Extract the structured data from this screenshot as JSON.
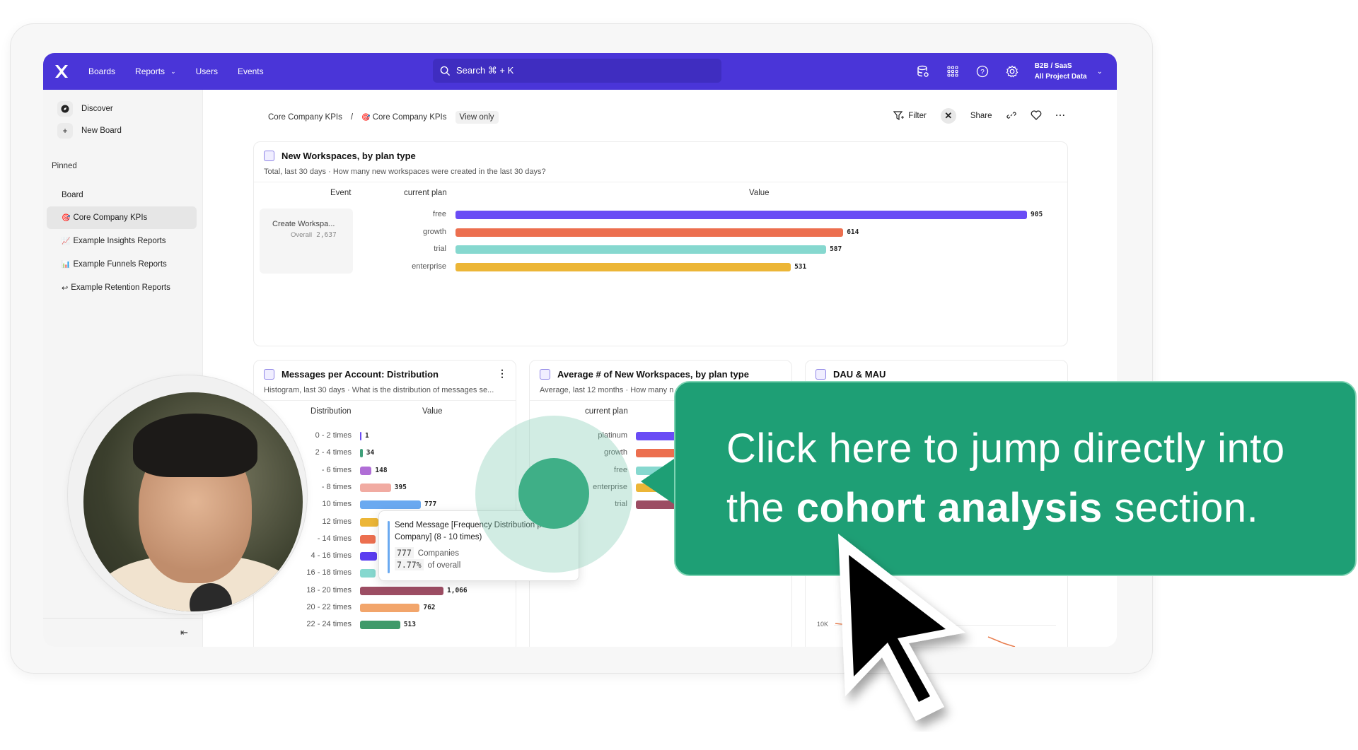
{
  "topnav": {
    "links": [
      {
        "label": "Boards"
      },
      {
        "label": "Reports",
        "has_dropdown": true
      },
      {
        "label": "Users"
      },
      {
        "label": "Events"
      }
    ],
    "search_placeholder": "Search  ⌘ + K",
    "icons": [
      "database-settings-icon",
      "apps-grid-icon",
      "help-icon",
      "settings-gear-icon"
    ],
    "project": {
      "name": "B2B / SaaS",
      "scope": "All Project Data"
    },
    "brand_color": "#4a35d8"
  },
  "sidebar": {
    "top_items": [
      {
        "label": "Discover",
        "icon": "compass-icon"
      },
      {
        "label": "New Board",
        "icon": "plus-icon"
      }
    ],
    "pinned_label": "Pinned",
    "pinned": [
      {
        "label": "Board",
        "emoji": ""
      },
      {
        "label": "Core Company KPIs",
        "emoji": "🎯",
        "active": true
      },
      {
        "label": "Example Insights Reports",
        "emoji": "📈"
      },
      {
        "label": "Example Funnels Reports",
        "emoji": "📊"
      },
      {
        "label": "Example Retention Reports",
        "emoji": "↩"
      }
    ],
    "collapse_icon": "⇤"
  },
  "breadcrumb": {
    "parent": "Core Company KPIs",
    "separator": "/",
    "current_emoji": "🎯",
    "current": "Core Company KPIs",
    "badge": "View only"
  },
  "actions": {
    "filter": "Filter",
    "share": "Share"
  },
  "cards": {
    "new_workspaces": {
      "title": "New Workspaces, by plan type",
      "subtitle": "Total, last 30 days · How many new workspaces were created in the last 30 days?",
      "col_event": "Event",
      "col_plan": "current plan",
      "col_value": "Value",
      "event_name": "Create Workspa...",
      "event_overall_label": "Overall",
      "event_overall_value": "2,637"
    },
    "messages": {
      "title": "Messages per Account: Distribution",
      "subtitle": "Histogram, last 30 days · What is the distribution of messages se...",
      "col_dist": "Distribution",
      "col_value": "Value"
    },
    "avg_workspaces": {
      "title": "Average # of New Workspaces, by plan type",
      "subtitle": "Average, last 12 months · How many n",
      "col_plan": "current plan"
    },
    "dau_mau": {
      "title": "DAU & MAU",
      "axis_tick": "10K"
    }
  },
  "tooltip": {
    "line1": "Send Message [Frequency Distribution per",
    "line2": "Company] (8 - 10 times)",
    "count": "777",
    "count_label": "Companies",
    "pct": "7.77%",
    "pct_label": "of overall"
  },
  "callout": {
    "line1": "Click here to jump directly into",
    "line2_pre": "the ",
    "line2_bold": "cohort analysis",
    "line2_post": " section.",
    "color": "#1e9f75"
  },
  "chart_data": [
    {
      "type": "bar",
      "title": "New Workspaces, by plan type",
      "orientation": "horizontal",
      "categories": [
        "free",
        "growth",
        "trial",
        "enterprise"
      ],
      "values": [
        905,
        614,
        587,
        531
      ],
      "labels": [
        "905",
        "614",
        "587",
        "531"
      ],
      "colors": [
        "#6a4cf5",
        "#ec6f4f",
        "#86d8cf",
        "#ecb637"
      ],
      "xlim": [
        0,
        905
      ]
    },
    {
      "type": "bar",
      "title": "Messages per Account: Distribution",
      "orientation": "horizontal",
      "categories": [
        "0 - 2 times",
        "2 - 4 times",
        "4 - 6 times",
        "6 - 8 times",
        "8 - 10 times",
        "10 - 12 times",
        "12 - 14 times",
        "14 - 16 times",
        "16 - 18 times",
        "18 - 20 times",
        "20 - 22 times",
        "22 - 24 times"
      ],
      "visible_labels": [
        "0 - 2 times",
        "2 - 4 times",
        "- 6 times",
        "- 8 times",
        "10 times",
        "12 times",
        "- 14 times",
        "4 - 16 times",
        "16 - 18 times",
        "18 - 20 times",
        "20 - 22 times",
        "22 - 24 times"
      ],
      "values": [
        1,
        34,
        148,
        395,
        777,
        null,
        null,
        null,
        null,
        1066,
        762,
        513
      ],
      "labels": [
        "1",
        "34",
        "148",
        "395",
        "777",
        "",
        "",
        "",
        "",
        "1,066",
        "762",
        "513"
      ],
      "colors": [
        "#6a4cf5",
        "#3fa07a",
        "#b06ed6",
        "#f1aba2",
        "#6aa9f0",
        "#ecb637",
        "#ec6f4f",
        "#5a3df0",
        "#86d8cf",
        "#9c4d63",
        "#f2a56b",
        "#3f9a6a"
      ],
      "xlim": [
        0,
        1066
      ]
    },
    {
      "type": "bar",
      "title": "Average # of New Workspaces, by plan type",
      "orientation": "horizontal",
      "categories": [
        "platinum",
        "growth",
        "free",
        "enterprise",
        "trial"
      ],
      "values": [
        null,
        null,
        null,
        null,
        null
      ],
      "colors": [
        "#6a4cf5",
        "#ec6f4f",
        "#86d8cf",
        "#ecb637",
        "#9c4d63"
      ]
    },
    {
      "type": "line",
      "title": "DAU & MAU",
      "y_ticks": [
        "10K"
      ],
      "series": [
        {
          "name": "",
          "color": "#e87c4c",
          "values": []
        }
      ]
    }
  ]
}
